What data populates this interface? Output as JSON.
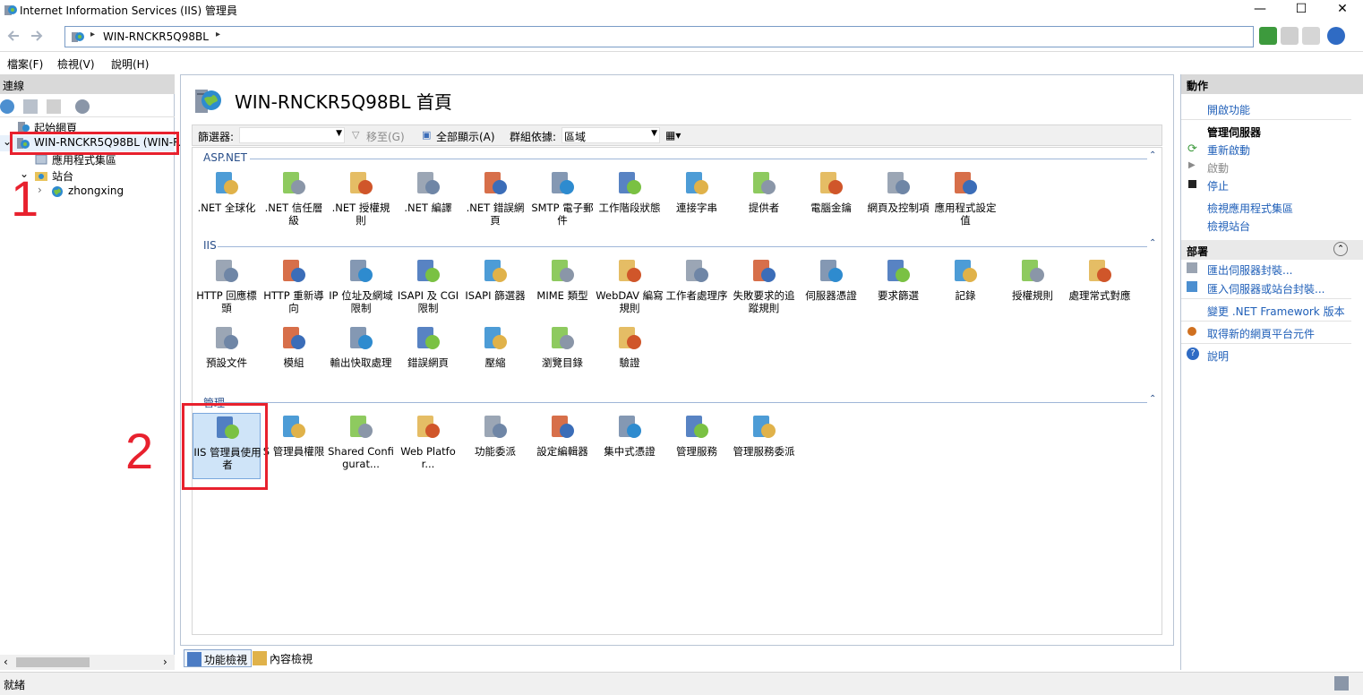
{
  "window": {
    "title": "Internet Information Services (IIS) 管理員",
    "controls": {
      "minimize": "—",
      "maximize": "☐",
      "close": "✕"
    }
  },
  "address": {
    "crumb": "WIN-RNCKR5Q98BL",
    "sep_before": "▸",
    "sep_after": "▸"
  },
  "menu": [
    "檔案(F)",
    "檢視(V)",
    "說明(H)"
  ],
  "connections": {
    "header": "連線",
    "tree": [
      {
        "label": "起始網頁",
        "icon": "start-page-icon"
      },
      {
        "label": "WIN-RNCKR5Q98BL (WIN-R",
        "icon": "server-icon",
        "expander": "⌄"
      },
      {
        "label": "應用程式集區",
        "icon": "app-pool-icon"
      },
      {
        "label": "站台",
        "icon": "sites-folder-icon",
        "expander": "⌄"
      },
      {
        "label": "zhongxing",
        "icon": "globe-icon",
        "expander": "›"
      }
    ],
    "scroll_left": "‹",
    "scroll_right": "›"
  },
  "page": {
    "title": "WIN-RNCKR5Q98BL 首頁",
    "filter": {
      "label": "篩選器:",
      "go": "移至(G)",
      "show_all": "全部顯示(A)",
      "group_by_label": "群組依據:",
      "group_by_value": "區域"
    },
    "groups": [
      {
        "name": "ASP.NET",
        "features": [
          {
            "label": ".NET 全球化",
            "icon": "globalization-icon"
          },
          {
            "label": ".NET 信任層級",
            "icon": "trust-level-icon"
          },
          {
            "label": ".NET 授權規則",
            "icon": "authorization-rules-icon"
          },
          {
            "label": ".NET 編譯",
            "icon": "compilation-icon"
          },
          {
            "label": ".NET 錯誤網頁",
            "icon": "error-pages-icon"
          },
          {
            "label": "SMTP 電子郵件",
            "icon": "smtp-email-icon"
          },
          {
            "label": "工作階段狀態",
            "icon": "session-state-icon"
          },
          {
            "label": "連接字串",
            "icon": "connection-strings-icon"
          },
          {
            "label": "提供者",
            "icon": "providers-icon"
          },
          {
            "label": "電腦金鑰",
            "icon": "machine-key-icon"
          },
          {
            "label": "網頁及控制項",
            "icon": "pages-controls-icon"
          },
          {
            "label": "應用程式設定值",
            "icon": "app-settings-icon"
          }
        ]
      },
      {
        "name": "IIS",
        "features": [
          {
            "label": "HTTP 回應標頭",
            "icon": "http-headers-icon"
          },
          {
            "label": "HTTP 重新導向",
            "icon": "http-redirect-icon"
          },
          {
            "label": "IP 位址及網域限制",
            "icon": "ip-restrictions-icon"
          },
          {
            "label": "ISAPI 及 CGI 限制",
            "icon": "isapi-cgi-icon"
          },
          {
            "label": "ISAPI 篩選器",
            "icon": "isapi-filters-icon"
          },
          {
            "label": "MIME 類型",
            "icon": "mime-types-icon"
          },
          {
            "label": "WebDAV 編寫規則",
            "icon": "webdav-icon"
          },
          {
            "label": "工作者處理序",
            "icon": "worker-processes-icon"
          },
          {
            "label": "失敗要求的追蹤規則",
            "icon": "failed-request-icon"
          },
          {
            "label": "伺服器憑證",
            "icon": "server-certificates-icon"
          },
          {
            "label": "要求篩選",
            "icon": "request-filtering-icon"
          },
          {
            "label": "記錄",
            "icon": "logging-icon"
          },
          {
            "label": "授權規則",
            "icon": "auth-rules-icon"
          },
          {
            "label": "處理常式對應",
            "icon": "handler-mappings-icon"
          },
          {
            "label": "預設文件",
            "icon": "default-document-icon"
          },
          {
            "label": "模組",
            "icon": "modules-icon"
          },
          {
            "label": "輸出快取處理",
            "icon": "output-caching-icon"
          },
          {
            "label": "錯誤網頁",
            "icon": "error-pages-icon"
          },
          {
            "label": "壓縮",
            "icon": "compression-icon"
          },
          {
            "label": "瀏覽目錄",
            "icon": "directory-browsing-icon"
          },
          {
            "label": "驗證",
            "icon": "authentication-icon"
          }
        ]
      },
      {
        "name": "管理",
        "features": [
          {
            "label": "IIS 管理員使用者",
            "icon": "iis-manager-users-icon",
            "selected": true
          },
          {
            "label": "S 管理員權限",
            "icon": "iis-manager-permissions-icon"
          },
          {
            "label": "Shared Configurat...",
            "icon": "shared-configuration-icon"
          },
          {
            "label": "Web Platfor...",
            "icon": "web-platform-icon"
          },
          {
            "label": "功能委派",
            "icon": "feature-delegation-icon"
          },
          {
            "label": "設定編輯器",
            "icon": "config-editor-icon"
          },
          {
            "label": "集中式憑證",
            "icon": "centralized-certs-icon"
          },
          {
            "label": "管理服務",
            "icon": "management-service-icon"
          },
          {
            "label": "管理服務委派",
            "icon": "management-delegation-icon"
          }
        ]
      }
    ],
    "collapse_glyph": "⌃"
  },
  "bottom_tabs": [
    {
      "label": "功能檢視",
      "icon": "features-view-icon",
      "active": true
    },
    {
      "label": "內容檢視",
      "icon": "content-view-icon"
    }
  ],
  "actions": {
    "header": "動作",
    "open_feature": "開啟功能",
    "manage_server_head": "管理伺服器",
    "restart": "重新啟動",
    "start": "啟動",
    "stop": "停止",
    "view_pools": "檢視應用程式集區",
    "view_sites": "檢視站台",
    "deploy_head": "部署",
    "export_pkg": "匯出伺服器封裝...",
    "import_pkg": "匯入伺服器或站台封裝...",
    "change_net": "變更 .NET Framework 版本",
    "get_web_platform": "取得新的網頁平台元件",
    "help": "說明"
  },
  "status": {
    "text": "就緒"
  },
  "annotations": {
    "num1": "1",
    "num2": "2"
  },
  "colors": {
    "annotation": "#e8212e",
    "link": "#1f5fb8",
    "group_label": "#2a4f8a"
  }
}
